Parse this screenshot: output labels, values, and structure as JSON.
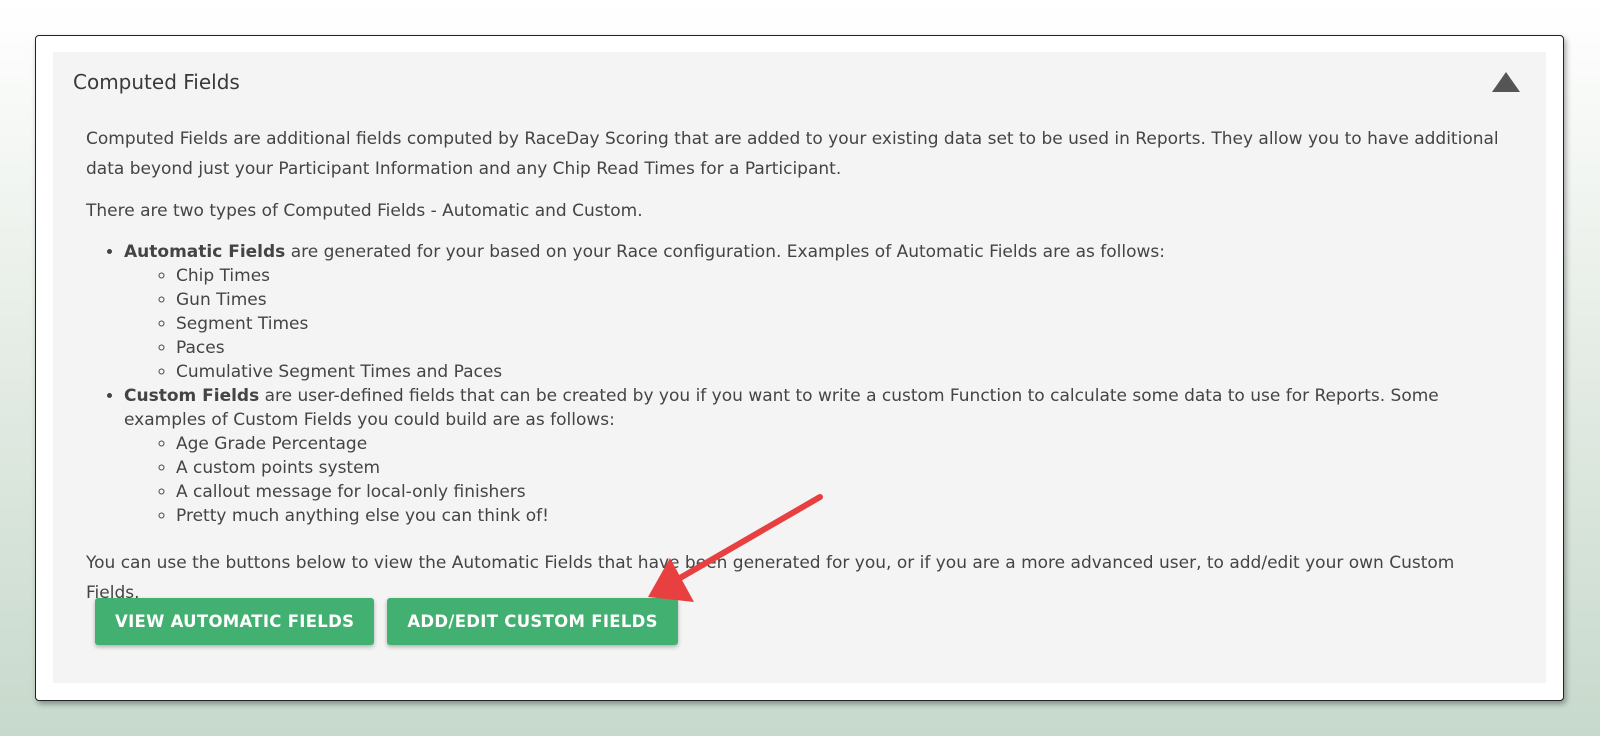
{
  "panel": {
    "title": "Computed Fields"
  },
  "body": {
    "intro": "Computed Fields are additional fields computed by RaceDay Scoring that are added to your existing data set to be used in Reports. They allow you to have additional data beyond just your Participant Information and any Chip Read Times for a Participant.",
    "types": "There are two types of Computed Fields - Automatic and Custom.",
    "automatic": {
      "label": "Automatic Fields",
      "text": " are generated for your based on your Race configuration. Examples of Automatic Fields are as follows:",
      "items": [
        "Chip Times",
        "Gun Times",
        "Segment Times",
        "Paces",
        "Cumulative Segment Times and Paces"
      ]
    },
    "custom": {
      "label": "Custom Fields",
      "text": " are user-defined fields that can be created by you if you want to write a custom Function to calculate some data to use for Reports. Some examples of Custom Fields you could build are as follows:",
      "items": [
        "Age Grade Percentage",
        "A custom points system",
        "A callout message for local-only finishers",
        "Pretty much anything else you can think of!"
      ]
    },
    "closing": "You can use the buttons below to view the Automatic Fields that have been generated for you, or if you are a more advanced user, to add/edit your own Custom Fields."
  },
  "buttons": {
    "view_automatic": "VIEW AUTOMATIC FIELDS",
    "add_edit_custom": "ADD/EDIT CUSTOM FIELDS"
  },
  "colors": {
    "button": "#41b070",
    "arrow": "#e84040",
    "panel_bg": "#f4f4f4"
  }
}
